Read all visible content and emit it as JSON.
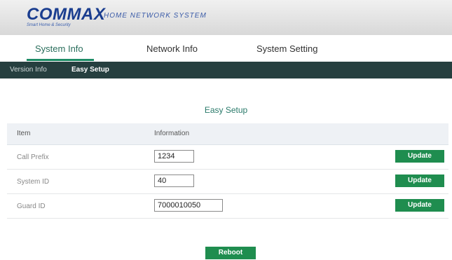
{
  "header": {
    "logo_text": "COMMAX",
    "logo_tagline": "Smart Home & Security",
    "subtitle": "HOME NETWORK SYSTEM"
  },
  "tabs": [
    {
      "label": "System Info",
      "active": true
    },
    {
      "label": "Network Info",
      "active": false
    },
    {
      "label": "System Setting",
      "active": false
    }
  ],
  "subnav": [
    {
      "label": "Version Info",
      "active": false
    },
    {
      "label": "Easy Setup",
      "active": true
    }
  ],
  "section_title": "Easy Setup",
  "table": {
    "headers": [
      "Item",
      "Information"
    ],
    "rows": [
      {
        "label": "Call Prefix",
        "value": "1234",
        "button": "Update"
      },
      {
        "label": "System ID",
        "value": "40",
        "button": "Update"
      },
      {
        "label": "Guard ID",
        "value": "7000010050",
        "button": "Update"
      }
    ]
  },
  "reboot_label": "Reboot",
  "colors": {
    "accent_green": "#1f8d4f",
    "subnav_bg": "#263f3f",
    "brand_blue": "#1a3d8f"
  }
}
